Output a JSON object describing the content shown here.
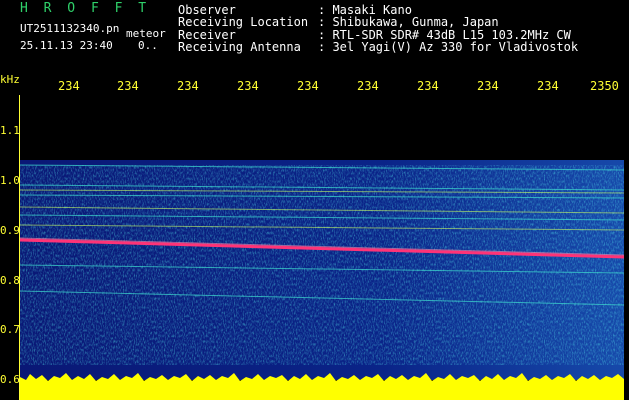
{
  "header": {
    "app_logo": "H R O F F T",
    "file_name": "UT2511132340.pn",
    "file_suffix": "meteor",
    "date_time": "25.11.13 23:40",
    "counter": "0..",
    "fields": [
      {
        "label": "Observer",
        "value": ": Masaki Kano"
      },
      {
        "label": "Receiving Location",
        "value": ": Shibukawa, Gunma, Japan"
      },
      {
        "label": "Receiver",
        "value": ": RTL-SDR SDR# 43dB L15 103.2MHz CW"
      },
      {
        "label": "Receiving Antenna",
        "value": ": 3el Yagi(V) Az 330 for Vladivostok"
      }
    ]
  },
  "axis": {
    "unit_label": "kHz",
    "time_ticks": [
      "234",
      "234",
      "234",
      "234",
      "234",
      "234",
      "234",
      "234",
      "234",
      "2350"
    ],
    "freq_ticks": [
      "1.1",
      "1.0",
      "0.9",
      "0.8",
      "0.7",
      "0.6"
    ]
  },
  "colors": {
    "axis_text": "#ffff33",
    "logo": "#2fd16a",
    "background_noise": "#0a1a80",
    "carrier_trace": "#ff3377",
    "meteor_trace": "#66ffcc",
    "amplitude_bar": "#ffff00"
  }
}
